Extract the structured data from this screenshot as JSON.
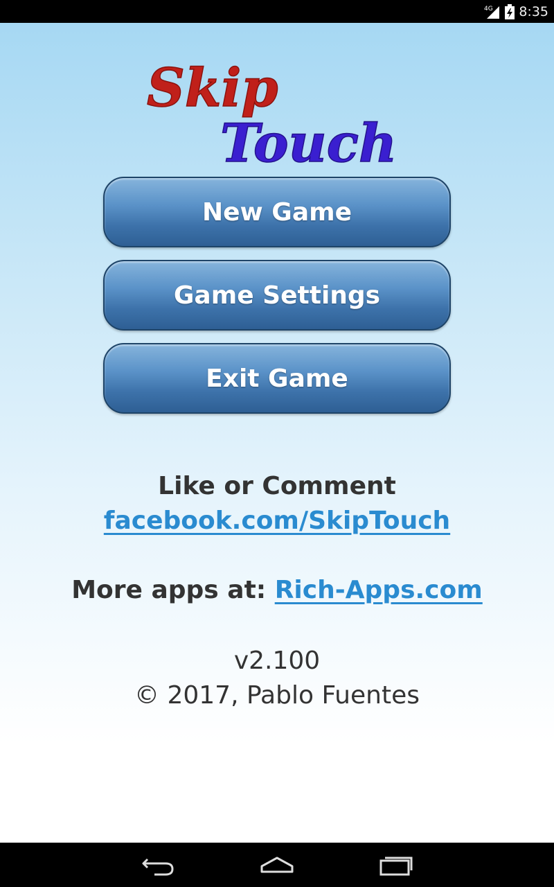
{
  "status_bar": {
    "network": "4G",
    "time": "8:35"
  },
  "logo": {
    "word1": "Skip",
    "word2": "Touch",
    "color1": "#c0201a",
    "color2": "#3a1fd0"
  },
  "menu": {
    "new_game": "New Game",
    "game_settings": "Game Settings",
    "exit_game": "Exit Game"
  },
  "footer": {
    "like_text": "Like or Comment",
    "facebook_link": "facebook.com/SkipTouch",
    "more_apps_label": "More apps at: ",
    "more_apps_link": "Rich-Apps.com",
    "version": "v2.100",
    "copyright": "© 2017, Pablo Fuentes"
  },
  "nav_bar": {
    "icons": [
      "back-icon",
      "home-icon",
      "recents-icon"
    ]
  },
  "colors": {
    "button_top": "#86b4dc",
    "button_bottom": "#2e5f94",
    "link": "#2a8bd0",
    "text": "#333333"
  }
}
